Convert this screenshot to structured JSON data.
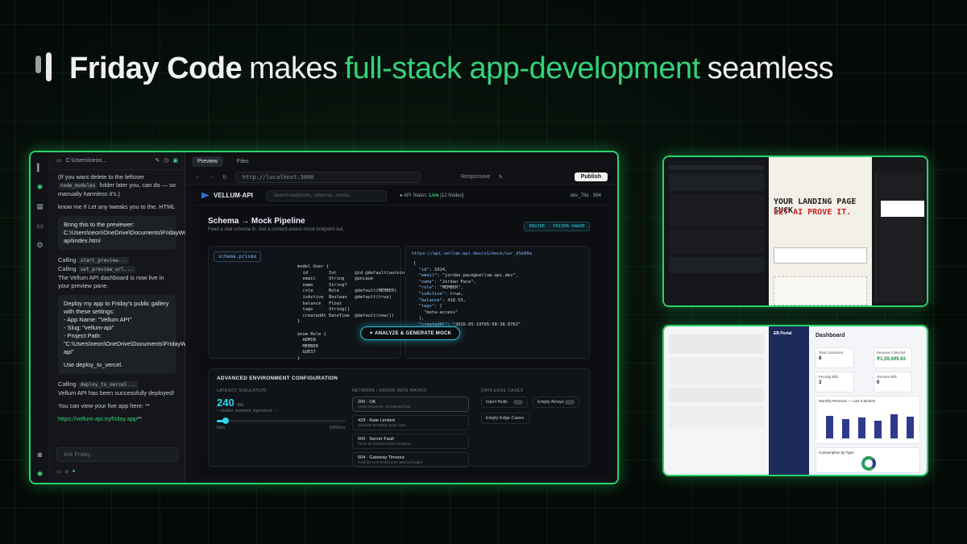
{
  "headline": {
    "brand": "Friday Code",
    "w1": "makes",
    "highlight": "full-stack app-development",
    "w2": "seamless"
  },
  "chat": {
    "path": "C:\\Users\\neon...",
    "m1a": "(If you want delete to the leftover",
    "m1code": "node_modules",
    "m1b": "folder later you, can do — so manually harmless it's.)",
    "m2": "know me if Let any tweaks you to the. HTML",
    "card1": "Bring this to the previewer: C:\\Users\\neon\\OneDrive\\Documents\\FridayWorkspace\\vellum-api\\index.html",
    "calling": "Calling",
    "call1": "start_preview...",
    "call2": "set_preview_url...",
    "m3": "The Vellum API dashboard is now live in your preview pane.",
    "card2a": "Deploy my app to Friday's public gallery with these settings:",
    "card2b": "- App Name: \"Vellum API\"",
    "card2c": "- Slug: \"vellum-api\"",
    "card2d": "- Project Path: \"C:\\Users\\neon\\OneDrive\\Documents\\FridayWorkspace\\vellum-api\"",
    "card2e": "Use deploy_to_vercel.",
    "call3": "deploy_to_vercel...",
    "m4": "Vellum API has been successfully deployed!",
    "m5": "You can view your live app here: **",
    "url": "https://vellum-api.tryfriday.app",
    "urlsuffix": "**",
    "input": "Ask Friday..."
  },
  "work": {
    "tab1": "Preview",
    "tab2": "Files",
    "url": "http://localhost:3000",
    "mode": "Responsive",
    "publish": "Publish",
    "brand": "VELLUM·API",
    "search": "Search endpoints, schemas, mocks...",
    "status_label": "API Status:",
    "status": "Live",
    "status_nodes": "[12 Nodes]",
    "user": "dev_78a · 994",
    "title": "Schema → Mock Pipeline",
    "subtitle": "Feed a real schema in. Get a context-aware mock endpoint out.",
    "badge": "ENGINE · PRISMA-AWARE",
    "schema_file": "schema.prisma",
    "resp_url": "https://api.vellum-api.dev/v1/mock/usr_d5e89a",
    "analyze": "✦ ANALYZE & GENERATE MOCK",
    "env_title": "ADVANCED ENVIRONMENT CONFIGURATION",
    "latency_label": "LATENCY SIMULATION",
    "latency_value": "240",
    "latency_unit": "ms",
    "latency_hint": "~ stable network signature ~",
    "lat_min": "0ms",
    "lat_max": "5000ms",
    "matrix_label": "NETWORK / ERROR RATE MATRIX",
    "opts": [
      {
        "t": "200 · OK",
        "s": "Clean response, no injected fault"
      },
      {
        "t": "429 · Rate Limited",
        "s": "Simulate throttling under load"
      },
      {
        "t": "500 · Server Fault",
        "s": "Force an internal crash exception"
      },
      {
        "t": "504 · Gateway Timeout",
        "s": "Hold the connection past latency budget"
      }
    ],
    "edge_label": "DATA EDGE CASES",
    "edge": [
      "Inject Nulls",
      "Empty Arrays",
      "Empty Edge Cases"
    ]
  },
  "side1": {
    "caption": "YOUR LANDING PAGE SUCK",
    "caption2": "LET AI PROVE IT."
  },
  "side2": {
    "title": "Dashboard",
    "kpis": [
      {
        "l": "Total Customers",
        "v": "8"
      },
      {
        "l": "Revenue Collected",
        "v": "₹1,59,699.63"
      },
      {
        "l": "Pending Bills",
        "v": "3"
      },
      {
        "l": "Overdue Bills",
        "v": "0"
      }
    ],
    "chart": "Monthly Revenue — Last 6 Months",
    "donut": "Consumption by Type",
    "brand": "EB Portal"
  }
}
